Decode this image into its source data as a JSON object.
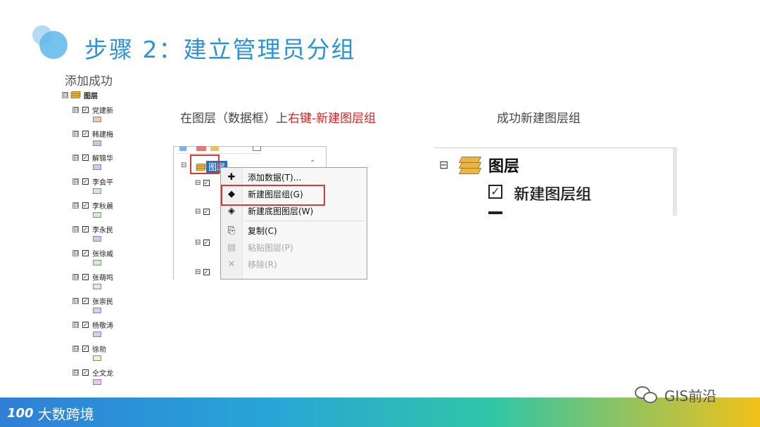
{
  "slide": {
    "title": "步骤 2：建立管理员分组",
    "subtitle": "添加成功"
  },
  "tree": {
    "root_label": "图层",
    "expander_symbol": "⊟",
    "items": [
      {
        "name": "党建新",
        "swatch": "#f4c6b6"
      },
      {
        "name": "韩建梅",
        "swatch": "#c9c9ef"
      },
      {
        "name": "解锦华",
        "swatch": "#d7c3ef"
      },
      {
        "name": "李会平",
        "swatch": "#cfeecb"
      },
      {
        "name": "李秋晨",
        "swatch": "#cfeecb"
      },
      {
        "name": "李永民",
        "swatch": "#d9c3f0"
      },
      {
        "name": "张徐威",
        "swatch": "#cfeecb"
      },
      {
        "name": "张萌鸣",
        "swatch": "#d3f0d8"
      },
      {
        "name": "张崇民",
        "swatch": "#c9d3f2"
      },
      {
        "name": "杨敬涛",
        "swatch": "#c9d3f2"
      },
      {
        "name": "徐勍",
        "swatch": "#eaf5cf"
      },
      {
        "name": "仝文龙",
        "swatch": "#f0c6ef"
      }
    ]
  },
  "caption_left": {
    "prefix": "在图层（数据框）上",
    "highlight": "右键-新建图层组",
    "highlight_color": "#e02020"
  },
  "caption_right": "成功新建图层组",
  "context_menu": {
    "selected_layer": "图层",
    "items": [
      {
        "label": "添加数据(T)...",
        "icon": "add-data-icon",
        "glyph": "✚",
        "enabled": true
      },
      {
        "label": "新建图层组(G)",
        "icon": "group-layer-icon",
        "glyph": "◆",
        "enabled": true
      },
      {
        "label": "新建底图图层(W)",
        "icon": "basemap-layer-icon",
        "glyph": "◈",
        "enabled": true
      },
      {
        "label": "复制(C)",
        "icon": "copy-icon",
        "glyph": "⎘",
        "enabled": true
      },
      {
        "label": "粘贴图层(P)",
        "icon": "paste-icon",
        "glyph": "▤",
        "enabled": false
      },
      {
        "label": "移除(R)",
        "icon": "remove-icon",
        "glyph": "✕",
        "enabled": false
      }
    ],
    "highlight_color": "#d23a3a"
  },
  "result_panel": {
    "root_label": "图层",
    "new_group_label": "新建图层组",
    "checked": true
  },
  "footer": {
    "brand_logo": "100",
    "brand_name": "大数跨境",
    "wechat_account": "GIS前沿"
  },
  "colors": {
    "title": "#2b93d6",
    "footer_start": "#2f7fd6",
    "footer_end": "#f2c11a"
  }
}
